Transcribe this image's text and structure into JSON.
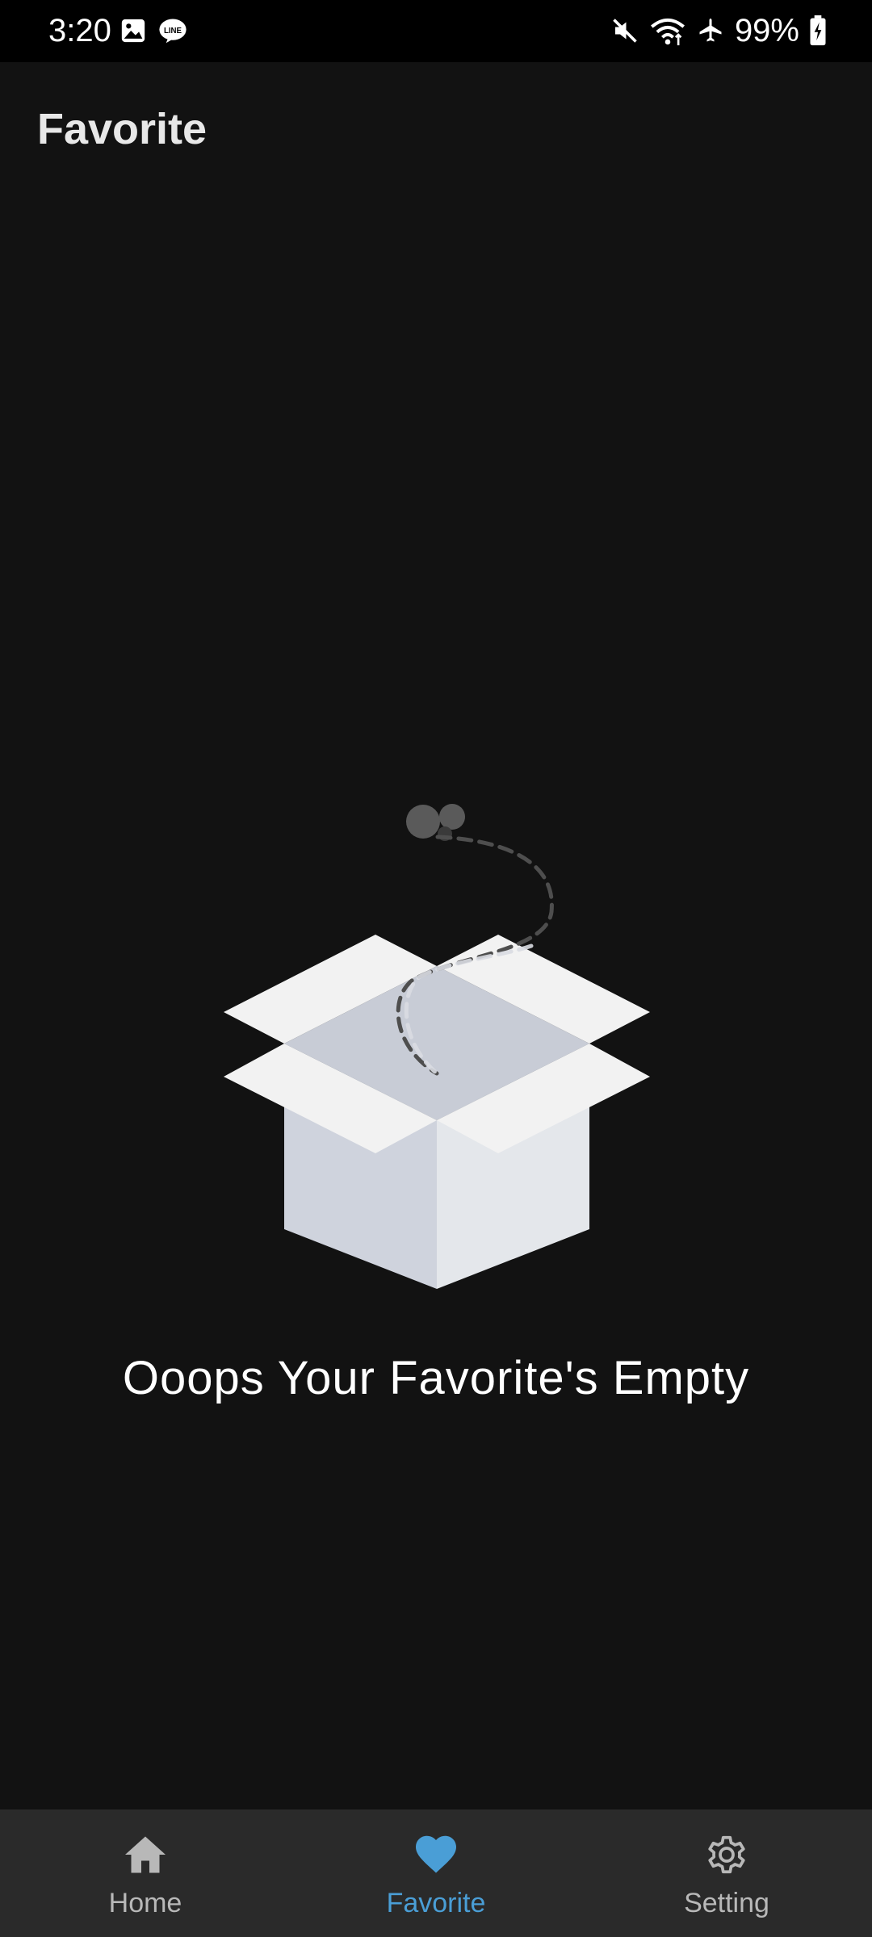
{
  "status_bar": {
    "time": "3:20",
    "battery_percent": "99%",
    "left_icons": [
      "gallery-icon",
      "line-icon"
    ],
    "right_icons": [
      "mute-icon",
      "wifi-icon",
      "airplane-icon",
      "battery-charging-icon"
    ]
  },
  "app_bar": {
    "title": "Favorite"
  },
  "empty_state": {
    "message": "Ooops Your Favorite's Empty",
    "illustration": "open-box-icon"
  },
  "bottom_nav": {
    "items": [
      {
        "label": "Home",
        "icon": "home-icon",
        "active": false
      },
      {
        "label": "Favorite",
        "icon": "heart-icon",
        "active": true
      },
      {
        "label": "Setting",
        "icon": "gear-icon",
        "active": false
      }
    ]
  },
  "colors": {
    "background": "#121212",
    "status_bar": "#000000",
    "nav_background": "#2a2a2a",
    "accent": "#4a9ed6",
    "inactive": "#b8b8b8"
  }
}
